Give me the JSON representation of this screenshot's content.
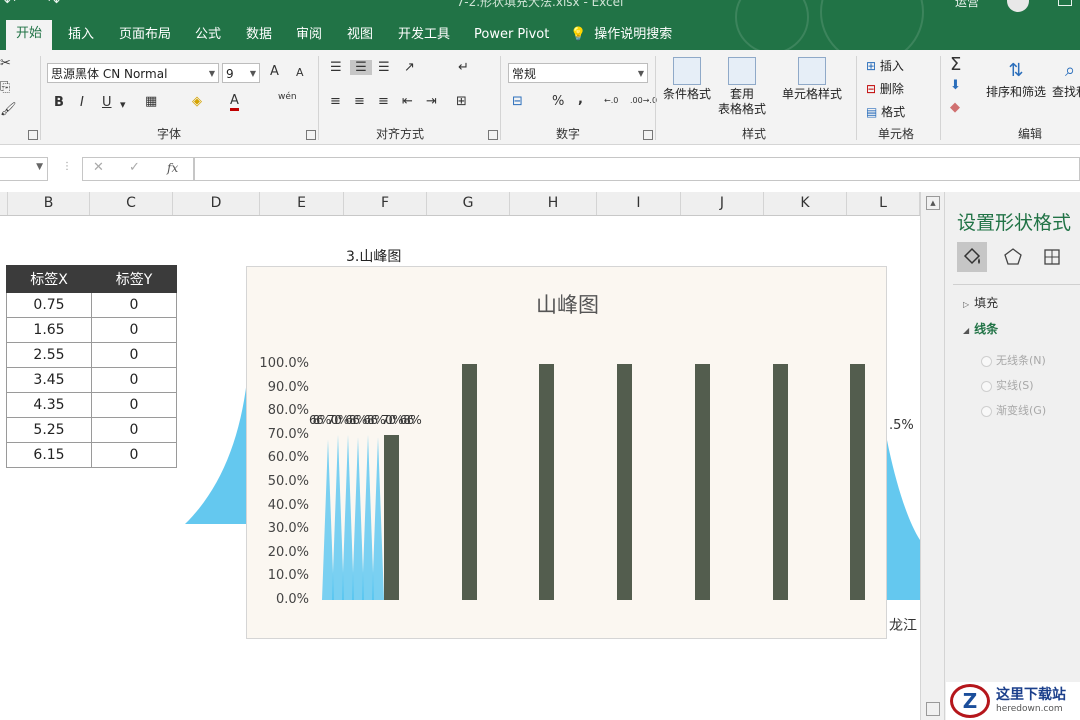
{
  "app": {
    "window_title": "7-2.形状填充大法.xlsx  -  Excel",
    "user_name": "运营",
    "tabs": [
      "开始",
      "插入",
      "页面布局",
      "公式",
      "数据",
      "审阅",
      "视图",
      "开发工具",
      "Power Pivot",
      "操作说明搜索"
    ],
    "active_tab": "开始"
  },
  "ribbon": {
    "font_name": "思源黑体 CN Normal",
    "font_size": "9",
    "grow_font": "A",
    "shrink_font": "A",
    "bold": "B",
    "italic": "I",
    "underline": "U",
    "wen_label": "wén",
    "number_format": "常规",
    "percent": "%",
    "comma": ",",
    "inc_decimal": "←.0",
    "dec_decimal": ".00→.0",
    "conditional_format": "条件格式",
    "table_format_1": "套用",
    "table_format_2": "表格格式",
    "cell_styles": "单元格样式",
    "insert": "插入",
    "delete": "删除",
    "format": "格式",
    "sort_filter": "排序和筛选",
    "find_select": "查找和",
    "groups": {
      "font": "字体",
      "alignment": "对齐方式",
      "number": "数字",
      "styles": "样式",
      "cells": "单元格",
      "editing": "编辑"
    }
  },
  "formula_bar": {
    "cancel": "✕",
    "enter": "✓",
    "fx": "fx",
    "value": ""
  },
  "grid": {
    "columns": [
      "B",
      "C",
      "D",
      "E",
      "F",
      "G",
      "H",
      "I",
      "J",
      "K",
      "L"
    ],
    "section_title": "3.山峰图",
    "label_table": {
      "headers": [
        "标签X",
        "标签Y"
      ],
      "rows": [
        [
          "0.75",
          "0"
        ],
        [
          "1.65",
          "0"
        ],
        [
          "2.55",
          "0"
        ],
        [
          "3.45",
          "0"
        ],
        [
          "4.35",
          "0"
        ],
        [
          "5.25",
          "0"
        ],
        [
          "6.15",
          "0"
        ]
      ]
    },
    "peeking_label_right": ".5%",
    "peeking_label_bottom": "龙江"
  },
  "chart_data": {
    "type": "bar",
    "title": "山峰图",
    "ylim": [
      0,
      1
    ],
    "y_ticks": [
      "100.0%",
      "90.0%",
      "80.0%",
      "70.0%",
      "60.0%",
      "50.0%",
      "40.0%",
      "30.0%",
      "20.0%",
      "10.0%",
      "0.0%"
    ],
    "bar_color": "#535d4e",
    "peak_color": "#4fc3f0",
    "series": [
      {
        "values": [
          0.7,
          1.0,
          1.0,
          1.0,
          1.0,
          1.0,
          1.0
        ]
      }
    ],
    "peaks": [
      {
        "values": [
          0.68,
          0.7,
          0.7,
          0.69,
          0.7,
          0.69
        ]
      }
    ],
    "peak_label_text": "68.6%70.0%68.6%68.6%70.0%68.6%"
  },
  "format_pane": {
    "title": "设置形状格式",
    "sections": [
      "填充",
      "线条"
    ],
    "line_options": [
      "无线条(N)",
      "实线(S)",
      "渐变线(G)"
    ]
  },
  "watermark": {
    "title": "这里下载站",
    "url": "heredown.com",
    "logo": "Z"
  }
}
